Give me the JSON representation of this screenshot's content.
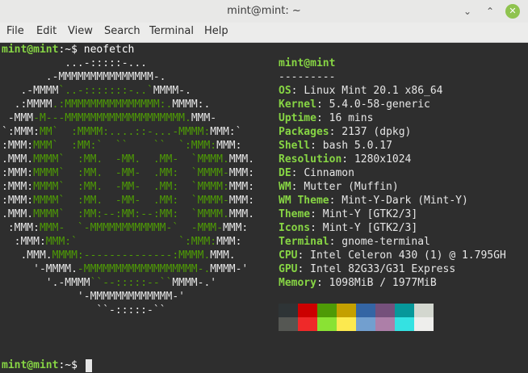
{
  "window": {
    "title": "mint@mint: ~"
  },
  "menu": [
    "File",
    "Edit",
    "View",
    "Search",
    "Terminal",
    "Help"
  ],
  "prompt": {
    "user_host": "mint@mint",
    "path": ":~$",
    "command": " neofetch"
  },
  "logo": [
    [
      [
        "w",
        "          ...-:::::-..."
      ]
    ],
    [
      [
        "w",
        "       .-MMMMMMMMMMMMMMM-."
      ]
    ],
    [
      [
        "w",
        "   .-MMMM"
      ],
      [
        "g",
        "`..-:::::::-..`"
      ],
      [
        "w",
        "MMMM-."
      ]
    ],
    [
      [
        "w",
        "  .:MMMM"
      ],
      [
        "g",
        ".:MMMMMMMMMMMMMMM:."
      ],
      [
        "w",
        "MMMM:."
      ]
    ],
    [
      [
        "w",
        " -MMM"
      ],
      [
        "g",
        "-M---MMMMMMMMMMMMMMMMMMM."
      ],
      [
        "w",
        "MMM-"
      ]
    ],
    [
      [
        "w",
        "`:MMM:"
      ],
      [
        "g",
        "MM`  :MMMM:....::-...-MMMM:"
      ],
      [
        "w",
        "MMM:`"
      ]
    ],
    [
      [
        "w",
        ":MMM:"
      ],
      [
        "g",
        "MMM`  :MM:`  ``    ``  `:MMM:"
      ],
      [
        "w",
        "MMM:"
      ]
    ],
    [
      [
        "w",
        ".MMM."
      ],
      [
        "g",
        "MMMM`  :MM.  -MM.  .MM-  `MMMM."
      ],
      [
        "w",
        "MMM."
      ]
    ],
    [
      [
        "w",
        ":MMM:"
      ],
      [
        "g",
        "MMMM`  :MM.  -MM-  .MM:  `MMMM-"
      ],
      [
        "w",
        "MMM:"
      ]
    ],
    [
      [
        "w",
        ":MMM:"
      ],
      [
        "g",
        "MMMM`  :MM.  -MM-  .MM:  `MMMM:"
      ],
      [
        "w",
        "MMM:"
      ]
    ],
    [
      [
        "w",
        ":MMM:"
      ],
      [
        "g",
        "MMMM`  :MM.  -MM-  .MM:  `MMMM-"
      ],
      [
        "w",
        "MMM:"
      ]
    ],
    [
      [
        "w",
        ".MMM."
      ],
      [
        "g",
        "MMMM`  :MM:--:MM:--:MM:  `MMMM."
      ],
      [
        "w",
        "MMM."
      ]
    ],
    [
      [
        "w",
        " :MMM:"
      ],
      [
        "g",
        "MMM-  `-MMMMMMMMMMMM-`  -MMM-"
      ],
      [
        "w",
        "MMM:"
      ]
    ],
    [
      [
        "w",
        "  :MMM:"
      ],
      [
        "g",
        "MMM:`                `:MMM:"
      ],
      [
        "w",
        "MMM:"
      ]
    ],
    [
      [
        "w",
        "   .MMM."
      ],
      [
        "g",
        "MMMM:--------------:MMMM."
      ],
      [
        "w",
        "MMM."
      ]
    ],
    [
      [
        "w",
        "     '-MMMM."
      ],
      [
        "g",
        "-MMMMMMMMMMMMMMMMMM-."
      ],
      [
        "w",
        "MMMM-'"
      ]
    ],
    [
      [
        "w",
        "       '.-MMMM"
      ],
      [
        "g",
        "``--:::::--``"
      ],
      [
        "w",
        "MMMM-.'"
      ]
    ],
    [
      [
        "w",
        "            '-MMMMMMMMMMMMM-'"
      ]
    ],
    [
      [
        "w",
        "               ``-:::::-``"
      ]
    ]
  ],
  "info": {
    "header": "mint@mint",
    "separator": "---------",
    "rows": [
      {
        "label": "OS",
        "value": "Linux Mint 20.1 x86_64"
      },
      {
        "label": "Kernel",
        "value": "5.4.0-58-generic"
      },
      {
        "label": "Uptime",
        "value": "16 mins"
      },
      {
        "label": "Packages",
        "value": "2137 (dpkg)"
      },
      {
        "label": "Shell",
        "value": "bash 5.0.17"
      },
      {
        "label": "Resolution",
        "value": "1280x1024"
      },
      {
        "label": "DE",
        "value": "Cinnamon"
      },
      {
        "label": "WM",
        "value": "Mutter (Muffin)"
      },
      {
        "label": "WM Theme",
        "value": "Mint-Y-Dark (Mint-Y)"
      },
      {
        "label": "Theme",
        "value": "Mint-Y [GTK2/3]"
      },
      {
        "label": "Icons",
        "value": "Mint-Y [GTK2/3]"
      },
      {
        "label": "Terminal",
        "value": "gnome-terminal"
      },
      {
        "label": "CPU",
        "value": "Intel Celeron 430 (1) @ 1.795GH"
      },
      {
        "label": "GPU",
        "value": "Intel 82G33/G31 Express"
      },
      {
        "label": "Memory",
        "value": "1098MiB / 1977MiB"
      }
    ]
  },
  "palette_top": [
    "#2e3436",
    "#cc0000",
    "#4e9a06",
    "#c4a000",
    "#3465a4",
    "#75507b",
    "#06989a",
    "#d3d7cf"
  ],
  "palette_bottom": [
    "#555753",
    "#ef2929",
    "#8ae234",
    "#fce94f",
    "#729fcf",
    "#ad7fa8",
    "#34e2e2",
    "#eeeeec"
  ],
  "final_prompt": {
    "user_host": "mint@mint",
    "path": ":~$"
  }
}
